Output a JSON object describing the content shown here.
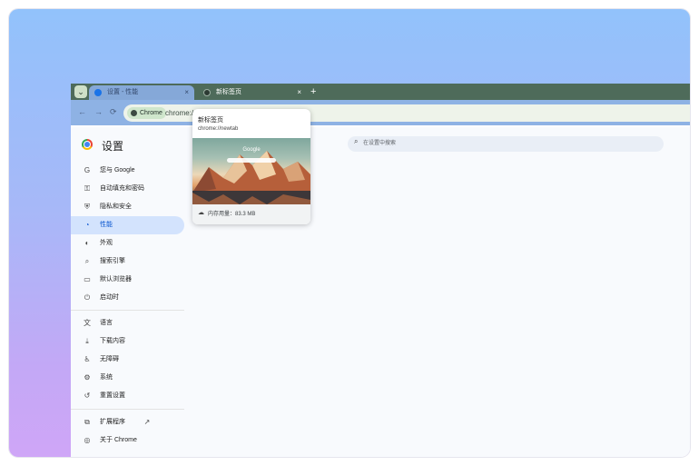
{
  "tabs": [
    {
      "title": "设置 - 性能",
      "active": true,
      "icon": "gear-icon"
    },
    {
      "title": "新标签页",
      "active": false,
      "icon": "chrome-icon"
    }
  ],
  "tab_menu_icon": "⌄",
  "tab_close_symbol": "×",
  "new_tab_symbol": "+",
  "toolbar": {
    "back": "←",
    "forward": "→",
    "reload": "⟳"
  },
  "omnibox": {
    "chip_label": "Chrome",
    "url": "chrome://settings/performance"
  },
  "settings": {
    "title": "设置",
    "search_placeholder": "在设置中搜索",
    "nav": [
      {
        "label": "您与 Google",
        "icon": "G"
      },
      {
        "label": "自动填充和密码",
        "icon": "⚿"
      },
      {
        "label": "隐私和安全",
        "icon": "⛨"
      },
      {
        "label": "性能",
        "icon": "◔",
        "active": true
      },
      {
        "label": "外观",
        "icon": "◐"
      },
      {
        "label": "搜索引擎",
        "icon": "⌕"
      },
      {
        "label": "默认浏览器",
        "icon": "▭"
      },
      {
        "label": "启动时",
        "icon": "⏻"
      },
      {
        "label": "语言",
        "icon": "文"
      },
      {
        "label": "下载内容",
        "icon": "⤓"
      },
      {
        "label": "无障碍",
        "icon": "♿"
      },
      {
        "label": "系统",
        "icon": "⚙"
      },
      {
        "label": "重置设置",
        "icon": "↺"
      },
      {
        "label": "扩展程序",
        "icon": "⧉",
        "trailing_icon": "↗"
      },
      {
        "label": "关于 Chrome",
        "icon": "◎"
      }
    ]
  },
  "hover_card": {
    "title": "新标签页",
    "url": "chrome://newtab",
    "thumb_label": "Google",
    "memory": "内存用量：83.3 MB"
  }
}
